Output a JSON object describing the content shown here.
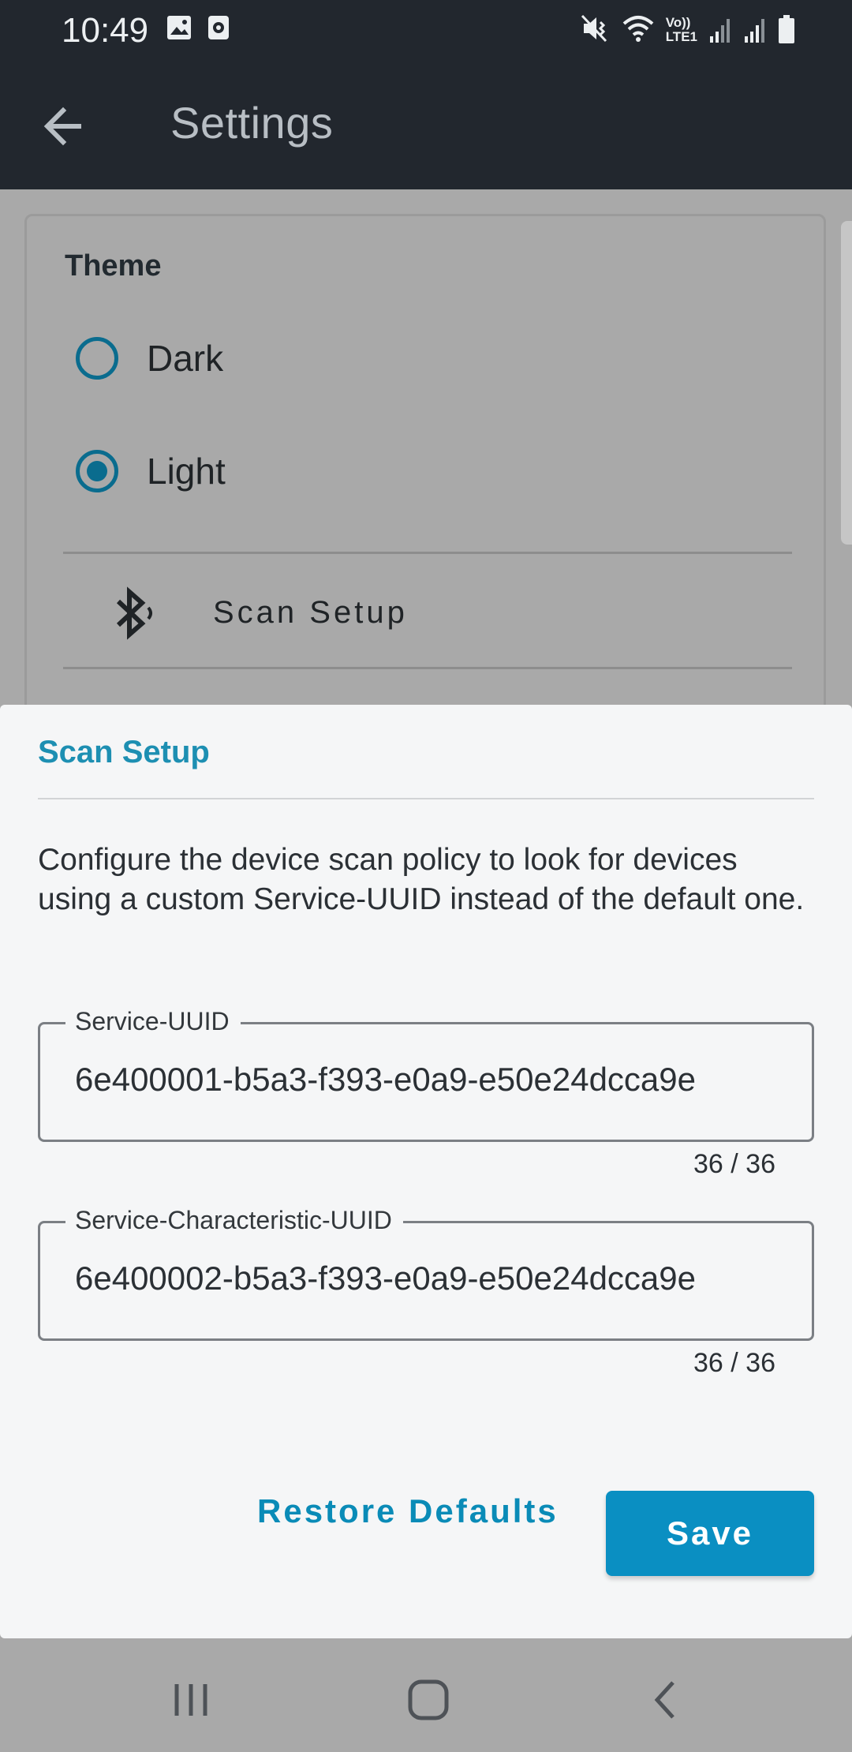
{
  "status_bar": {
    "time": "10:49",
    "left_icons": [
      "image-icon",
      "screen-record-icon"
    ],
    "right_icons": [
      "mute-vibrate-icon",
      "wifi-icon",
      "volte-lte1-icon",
      "signal-icon",
      "signal-icon",
      "battery-icon"
    ],
    "volte_text": "Vo))",
    "lte_text": "LTE1"
  },
  "app_bar": {
    "title": "Settings",
    "back_icon": "arrow-back-icon"
  },
  "settings": {
    "theme_label": "Theme",
    "options": [
      {
        "label": "Dark",
        "selected": false
      },
      {
        "label": "Light",
        "selected": true
      }
    ],
    "scan_setup_label": "Scan Setup",
    "scan_setup_icon": "bluetooth-scan-icon"
  },
  "dialog": {
    "title": "Scan Setup",
    "description": "Configure the device scan policy to look for devices using a custom Service-UUID instead of the default one.",
    "fields": [
      {
        "label": "Service-UUID",
        "value": "6e400001-b5a3-f393-e0a9-e50e24dcca9e",
        "counter": "36 / 36"
      },
      {
        "label": "Service-Characteristic-UUID",
        "value": "6e400002-b5a3-f393-e0a9-e50e24dcca9e",
        "counter": "36 / 36"
      }
    ],
    "restore_label": "Restore Defaults",
    "save_label": "Save"
  },
  "colors": {
    "accent": "#0a8fc2",
    "radio": "#0a6c8e",
    "appbar": "#22272e"
  },
  "nav_bar": {
    "icons": [
      "recent-apps-icon",
      "home-icon",
      "back-icon"
    ]
  }
}
